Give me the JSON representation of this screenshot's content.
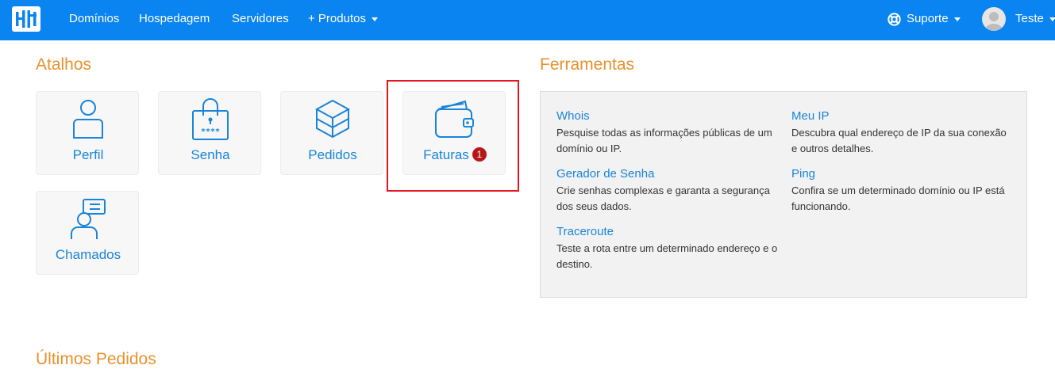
{
  "nav": {
    "links": [
      "Domínios",
      "Hospedagem",
      "Servidores",
      "+ Produtos"
    ],
    "support": "Suporte",
    "user": "Teste"
  },
  "shortcuts": {
    "title": "Atalhos",
    "items": [
      {
        "label": "Perfil",
        "icon": "user-icon"
      },
      {
        "label": "Senha",
        "icon": "lock-icon"
      },
      {
        "label": "Pedidos",
        "icon": "box-icon"
      },
      {
        "label": "Faturas",
        "icon": "wallet-icon",
        "badge": "1"
      },
      {
        "label": "Chamados",
        "icon": "support-ticket-icon"
      }
    ]
  },
  "tools": {
    "title": "Ferramentas",
    "items": [
      {
        "title": "Whois",
        "desc": "Pesquise todas as informações públicas de um domínio ou IP."
      },
      {
        "title": "Meu IP",
        "desc": "Descubra qual endereço de IP da sua conexão e outros detalhes."
      },
      {
        "title": "Gerador de Senha",
        "desc": "Crie senhas complexas e garanta a segurança dos seus dados."
      },
      {
        "title": "Ping",
        "desc": "Confira se um determinado domínio ou IP está funcionando."
      },
      {
        "title": "Traceroute",
        "desc": "Teste a rota entre um determinado endereço e o destino."
      }
    ]
  },
  "orders": {
    "title": "Últimos Pedidos"
  },
  "colors": {
    "navbar": "#0a84f0",
    "heading": "#e8912d",
    "link": "#1a84d8",
    "badge": "#b51818",
    "highlight": "#e5141e"
  }
}
